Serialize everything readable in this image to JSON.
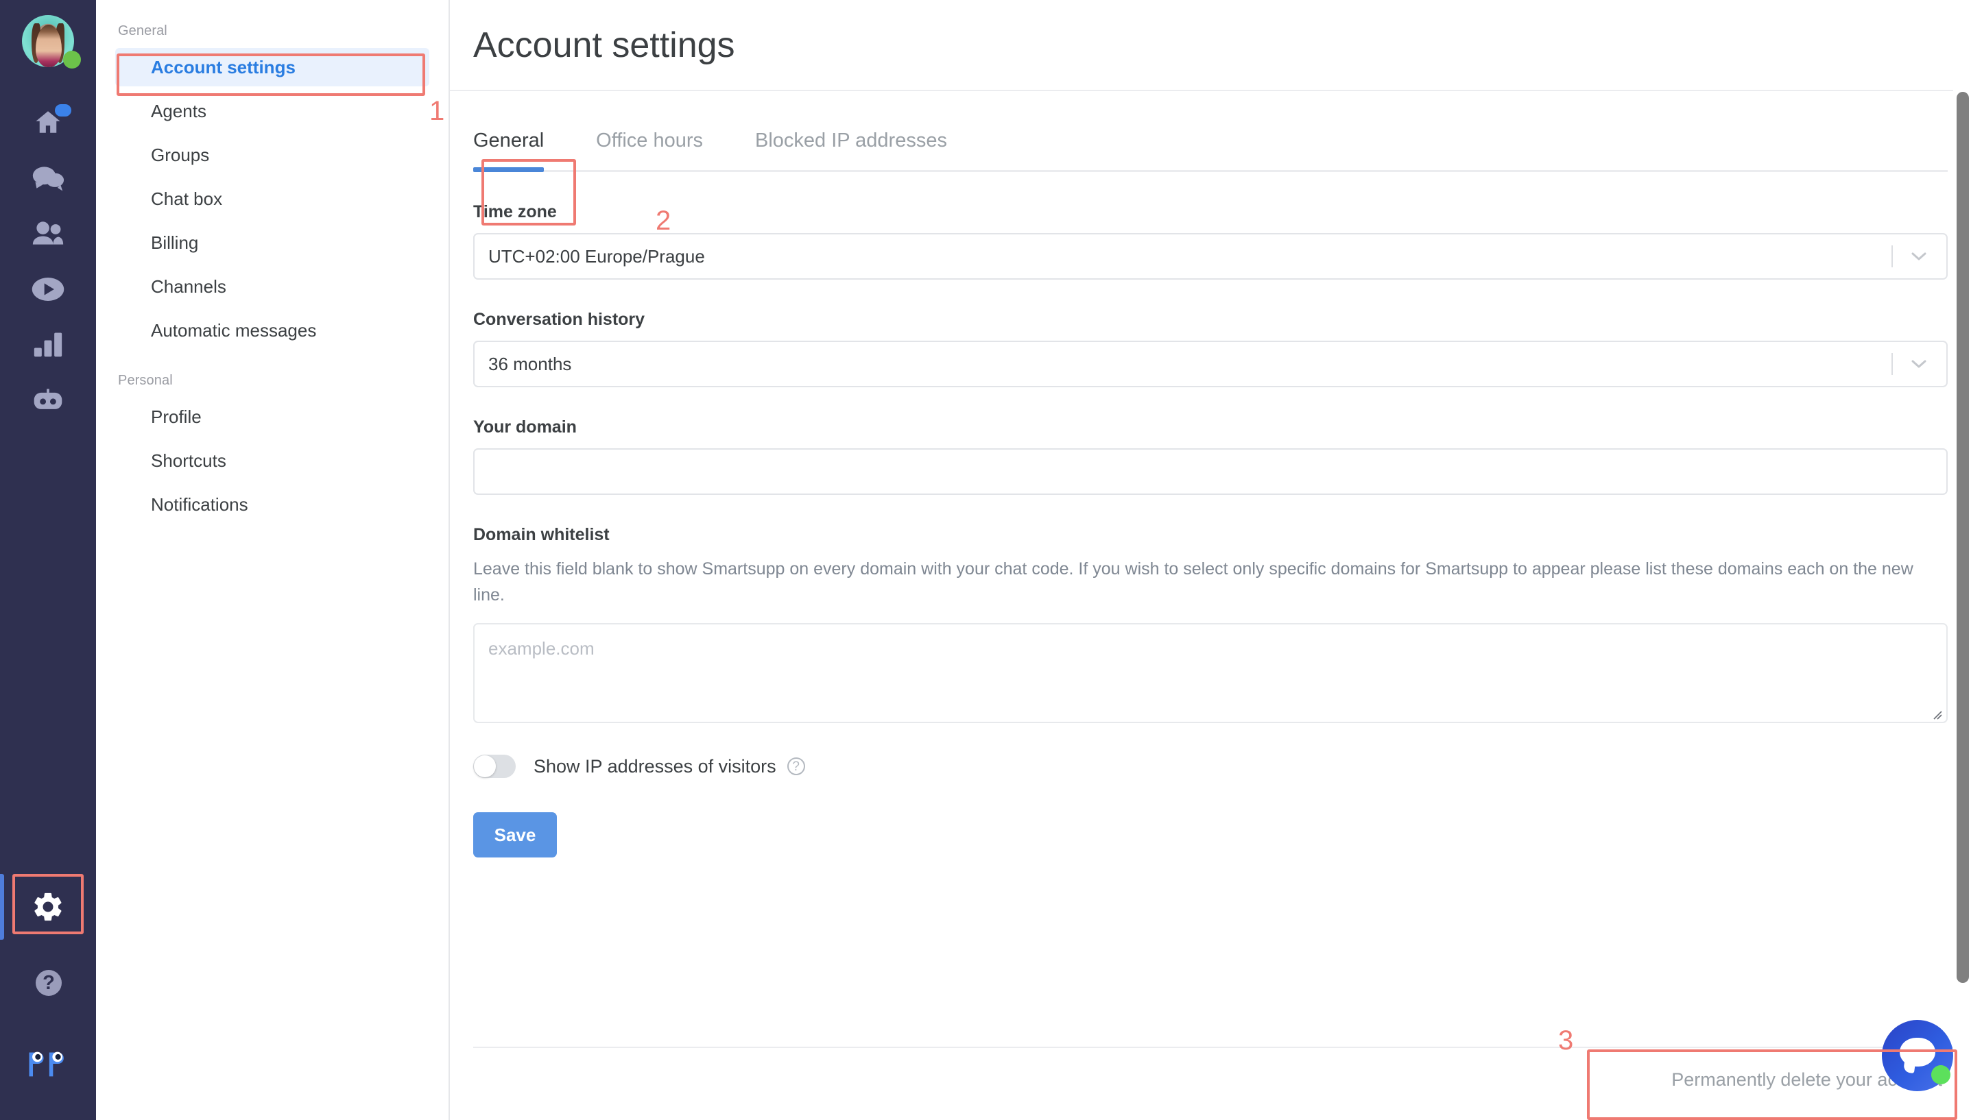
{
  "rail": {
    "avatar": {
      "name": "user-avatar",
      "status": "online"
    },
    "items": [
      {
        "name": "home-icon",
        "label": "Home",
        "badge": true
      },
      {
        "name": "conversations-icon",
        "label": "Conversations",
        "badge": false
      },
      {
        "name": "visitors-icon",
        "label": "Visitors",
        "badge": false
      },
      {
        "name": "recordings-icon",
        "label": "Recordings",
        "badge": false
      },
      {
        "name": "statistics-icon",
        "label": "Statistics",
        "badge": false
      },
      {
        "name": "chatbot-icon",
        "label": "Chatbot",
        "badge": false
      }
    ],
    "settings": {
      "name": "gear-icon",
      "label": "Settings",
      "active": true
    },
    "help": {
      "name": "help-icon",
      "label": "Help",
      "glyph": "?"
    },
    "logo": {
      "name": "brand-logo",
      "label": "Smartsupp"
    }
  },
  "sidebar": {
    "groups": [
      {
        "label": "General",
        "items": [
          {
            "label": "Account settings",
            "active": true
          },
          {
            "label": "Agents",
            "active": false
          },
          {
            "label": "Groups",
            "active": false
          },
          {
            "label": "Chat box",
            "active": false
          },
          {
            "label": "Billing",
            "active": false
          },
          {
            "label": "Channels",
            "active": false
          },
          {
            "label": "Automatic messages",
            "active": false
          }
        ]
      },
      {
        "label": "Personal",
        "items": [
          {
            "label": "Profile",
            "active": false
          },
          {
            "label": "Shortcuts",
            "active": false
          },
          {
            "label": "Notifications",
            "active": false
          }
        ]
      }
    ]
  },
  "header": {
    "title": "Account settings"
  },
  "tabs": [
    {
      "label": "General",
      "active": true
    },
    {
      "label": "Office hours",
      "active": false
    },
    {
      "label": "Blocked IP addresses",
      "active": false
    }
  ],
  "form": {
    "timezone": {
      "label": "Time zone",
      "value": "UTC+02:00 Europe/Prague",
      "caret": "chevron-down-icon"
    },
    "conversation_history": {
      "label": "Conversation history",
      "value": "36 months",
      "caret": "chevron-down-icon"
    },
    "your_domain": {
      "label": "Your domain",
      "value": "",
      "placeholder": ""
    },
    "domain_whitelist": {
      "label": "Domain whitelist",
      "help": "Leave this field blank to show Smartsupp on every domain with your chat code. If you wish to select only specific domains for Smartsupp to appear please list these domains each on the new line.",
      "value": "",
      "placeholder": "example.com"
    },
    "show_ip": {
      "label": "Show IP addresses of visitors",
      "enabled": false,
      "help_glyph": "?"
    },
    "save_label": "Save"
  },
  "footer": {
    "delete_label": "Permanently delete your account"
  },
  "chat_widget": {
    "name": "chat-bubble-widget",
    "status": "online"
  },
  "annotations": [
    {
      "number": "1",
      "target": "sidebar-item-account-settings"
    },
    {
      "number": "2",
      "target": "tab-general"
    },
    {
      "number": "3",
      "target": "delete-account-link"
    }
  ],
  "colors": {
    "accent": "#2a7de1",
    "tab_underline": "#4a86d8",
    "save_button": "#5a95e4",
    "annotation": "#ef7a72",
    "rail_bg": "#2f3050",
    "online": "#6cc24a"
  }
}
